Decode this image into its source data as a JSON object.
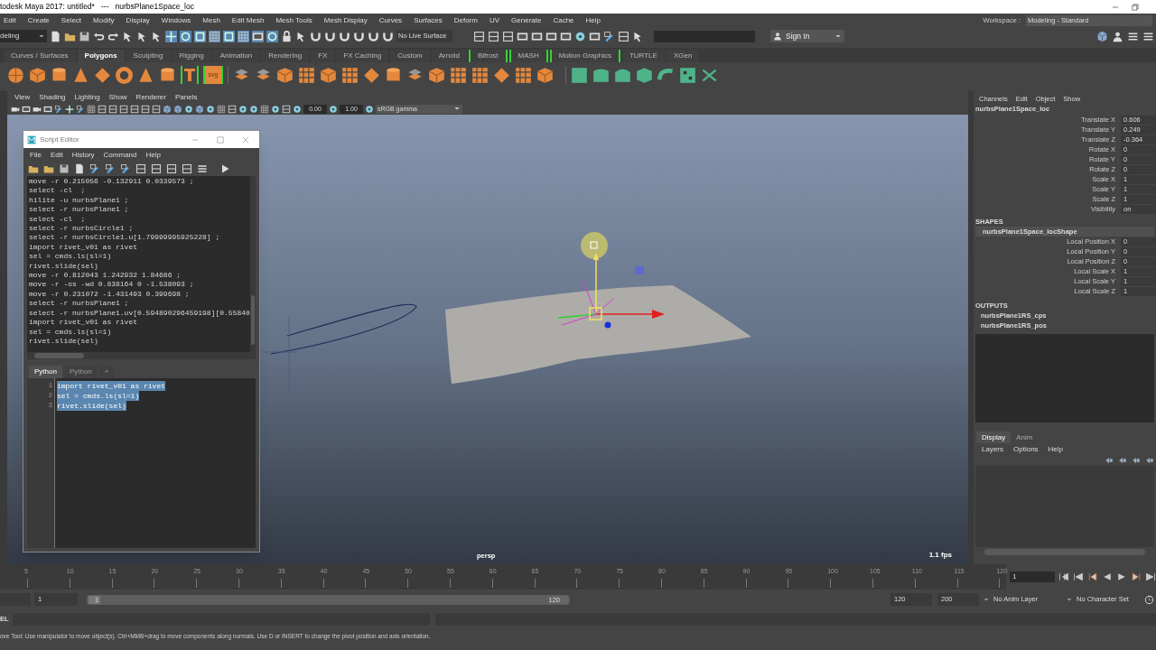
{
  "title_bar": {
    "title": "todesk Maya 2017: untitled*   ---   nurbsPlane1Space_loc"
  },
  "menu_bar": {
    "items": [
      "Edit",
      "Create",
      "Select",
      "Modify",
      "Display",
      "Windows",
      "Mesh",
      "Edit Mesh",
      "Mesh Tools",
      "Mesh Display",
      "Curves",
      "Surfaces",
      "Deform",
      "UV",
      "Generate",
      "Cache",
      "Help"
    ],
    "workspace_label": "Workspace :",
    "workspace": "Modeling - Standard"
  },
  "status_line": {
    "menu_set": "deling",
    "live_surface": "No Live Surface",
    "sign_in": "Sign In"
  },
  "shelf": {
    "tabs": [
      {
        "label": "Curves / Surfaces",
        "selected": false,
        "bracketed": false
      },
      {
        "label": "Polygons",
        "selected": true,
        "bracketed": false
      },
      {
        "label": "Sculpting",
        "selected": false,
        "bracketed": false
      },
      {
        "label": "Rigging",
        "selected": false,
        "bracketed": false
      },
      {
        "label": "Animation",
        "selected": false,
        "bracketed": false
      },
      {
        "label": "Rendering",
        "selected": false,
        "bracketed": false
      },
      {
        "label": "FX",
        "selected": false,
        "bracketed": false
      },
      {
        "label": "FX Caching",
        "selected": false,
        "bracketed": false
      },
      {
        "label": "Custom",
        "selected": false,
        "bracketed": false
      },
      {
        "label": "Arnold",
        "selected": false,
        "bracketed": false
      },
      {
        "label": "Bifrost",
        "selected": false,
        "bracketed": true
      },
      {
        "label": "MASH",
        "selected": false,
        "bracketed": true
      },
      {
        "label": "Motion Graphics",
        "selected": false,
        "bracketed": true
      },
      {
        "label": "TURTLE",
        "selected": false,
        "bracketed": false
      },
      {
        "label": "XGen",
        "selected": false,
        "bracketed": false
      }
    ],
    "svg_badge": "svg"
  },
  "viewport": {
    "menus": [
      "View",
      "Shading",
      "Lighting",
      "Show",
      "Renderer",
      "Panels"
    ],
    "exposure": "0.00",
    "gamma": "1.00",
    "color_space": "sRGB gamma",
    "camera": "persp",
    "fps": "1.1 fps"
  },
  "script_editor": {
    "title": "Script Editor",
    "menus": [
      "File",
      "Edit",
      "History",
      "Command",
      "Help"
    ],
    "history": [
      "move -r 0.215056 -0.132911 0.0339573 ;",
      "select -cl  ;",
      "hilite -u nurbsPlane1 ;",
      "select -r nurbsPlane1 ;",
      "select -cl  ;",
      "select -r nurbsCircle1 ;",
      "select -r nurbsCircle1.u[1.79999995925228] ;",
      "import rivet_v01 as rivet",
      "sel = cmds.ls(sl=1)",
      "rivet.slide(sel)",
      "move -r 0.812043 1.242932 1.84686 ;",
      "move -r -os -wd 0.838164 0 -1.538093 ;",
      "move -r 0.231072 -1.431493 0.399698 ;",
      "select -r nurbsPlane1 ;",
      "select -r nurbsPlane1.uv[0.594890296459198][0.55840",
      "import rivet_v01 as rivet",
      "sel = cmds.ls(sl=1)",
      "rivet.slide(sel)"
    ],
    "tabs": [
      {
        "label": "Python",
        "selected": true
      },
      {
        "label": "Python",
        "selected": false
      },
      {
        "label": "+",
        "selected": false
      }
    ],
    "input_lines": [
      {
        "number": "1",
        "code": "import rivet_v01 as rivet",
        "selected": true
      },
      {
        "number": "2",
        "code": "sel = cmds.ls(sl=1)",
        "selected": true
      },
      {
        "number": "3",
        "code": "rivet.slide(sel)",
        "selected": true
      }
    ]
  },
  "channel_box": {
    "menus": [
      "Channels",
      "Edit",
      "Object",
      "Show"
    ],
    "node": "nurbsPlane1Space_loc",
    "channels": [
      {
        "name": "Translate X",
        "value": "0.606"
      },
      {
        "name": "Translate Y",
        "value": "0.249"
      },
      {
        "name": "Translate Z",
        "value": "-0.364"
      },
      {
        "name": "Rotate X",
        "value": "0"
      },
      {
        "name": "Rotate Y",
        "value": "0"
      },
      {
        "name": "Rotate Z",
        "value": "0"
      },
      {
        "name": "Scale X",
        "value": "1"
      },
      {
        "name": "Scale Y",
        "value": "1"
      },
      {
        "name": "Scale Z",
        "value": "1"
      },
      {
        "name": "Visibility",
        "value": "on"
      }
    ],
    "shapes_heading": "SHAPES",
    "shape": "nurbsPlane1Space_locShape",
    "shape_channels": [
      {
        "name": "Local Position X",
        "value": "0"
      },
      {
        "name": "Local Position Y",
        "value": "0"
      },
      {
        "name": "Local Position Z",
        "value": "0"
      },
      {
        "name": "Local Scale X",
        "value": "1"
      },
      {
        "name": "Local Scale Y",
        "value": "1"
      },
      {
        "name": "Local Scale Z",
        "value": "1"
      }
    ],
    "outputs_heading": "OUTPUTS",
    "outputs": [
      "nurbsPlane1RS_cps",
      "nurbsPlane1RS_pos"
    ]
  },
  "layer_editor": {
    "tabs": [
      {
        "label": "Display",
        "selected": true
      },
      {
        "label": "Anim",
        "selected": false
      }
    ],
    "menus": [
      "Layers",
      "Options",
      "Help"
    ]
  },
  "time_slider": {
    "ticks": [
      "5",
      "10",
      "15",
      "20",
      "25",
      "30",
      "35",
      "40",
      "45",
      "50",
      "55",
      "60",
      "65",
      "70",
      "75",
      "80",
      "85",
      "90",
      "95",
      "100",
      "105",
      "110",
      "115",
      "120"
    ],
    "current_frame": "1"
  },
  "range_slider": {
    "start": "1",
    "bar_start": "1",
    "bar_end": "120",
    "playback_end": "120",
    "animation_end": "200",
    "anim_layer": "No Anim Layer",
    "character_set": "No Character Set"
  },
  "command_line": {
    "label": "EL"
  },
  "help_line": {
    "text": "ove Tool: Use manipulator to move object(s). Ctrl+MMB+drag to move components along normals. Use D or INSERT to change the pivot position and axis orientation."
  }
}
